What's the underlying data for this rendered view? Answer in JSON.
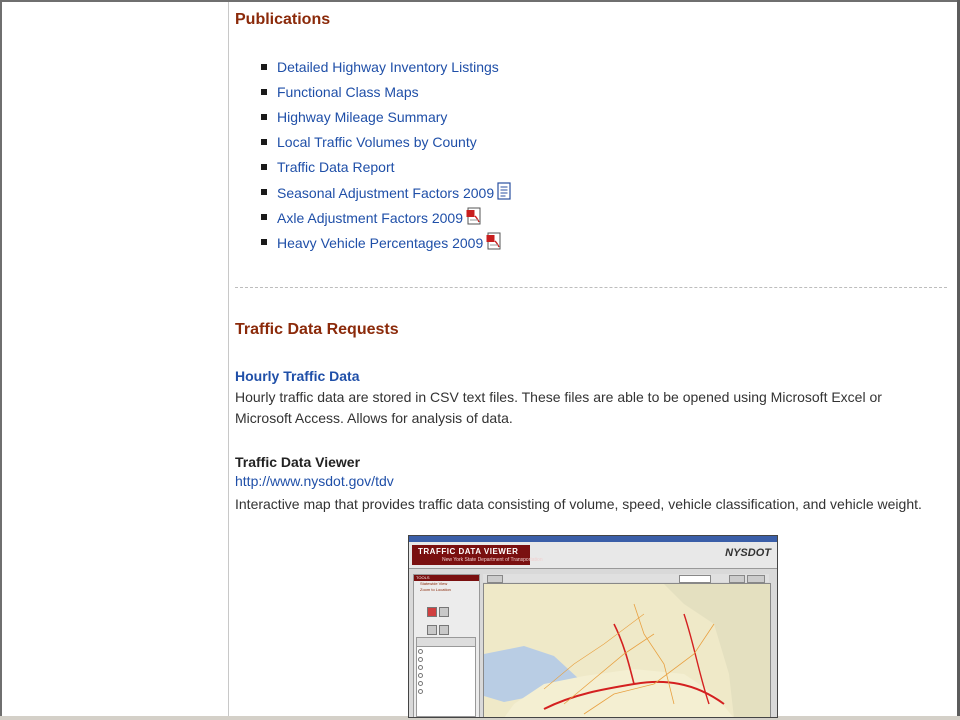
{
  "publications": {
    "heading": "Publications",
    "items": [
      {
        "label": "Detailed Highway Inventory Listings",
        "icon": ""
      },
      {
        "label": "Functional Class Maps",
        "icon": ""
      },
      {
        "label": "Highway Mileage Summary",
        "icon": ""
      },
      {
        "label": "Local Traffic Volumes by County",
        "icon": ""
      },
      {
        "label": "Traffic Data Report",
        "icon": ""
      },
      {
        "label": "Seasonal Adjustment Factors 2009",
        "icon": "text-document-icon"
      },
      {
        "label": "Axle Adjustment Factors 2009",
        "icon": "pdf-icon"
      },
      {
        "label": "Heavy Vehicle Percentages 2009",
        "icon": "pdf-icon"
      }
    ]
  },
  "requests": {
    "heading": "Traffic Data Requests",
    "hourly": {
      "title": "Hourly Traffic Data",
      "description": "Hourly traffic data are stored in CSV text files. These files are able to be opened using Microsoft Excel or Microsoft Access. Allows for analysis of data."
    },
    "viewer": {
      "title": "Traffic Data Viewer",
      "url": "http://www.nysdot.gov/tdv",
      "description": "Interactive map that provides traffic data consisting of volume, speed, vehicle classification, and vehicle weight.",
      "screenshot": {
        "app_title": "TRAFFIC DATA VIEWER",
        "app_subtitle": "New York State Department of Transportation",
        "brand": "NYSDOT",
        "tools_label": "TOOLS",
        "tool_items": [
          "Statewide View",
          "Zoom to Location"
        ]
      }
    }
  },
  "colors": {
    "heading": "#8b2a0a",
    "link": "#1f4fa8",
    "text": "#333333"
  }
}
